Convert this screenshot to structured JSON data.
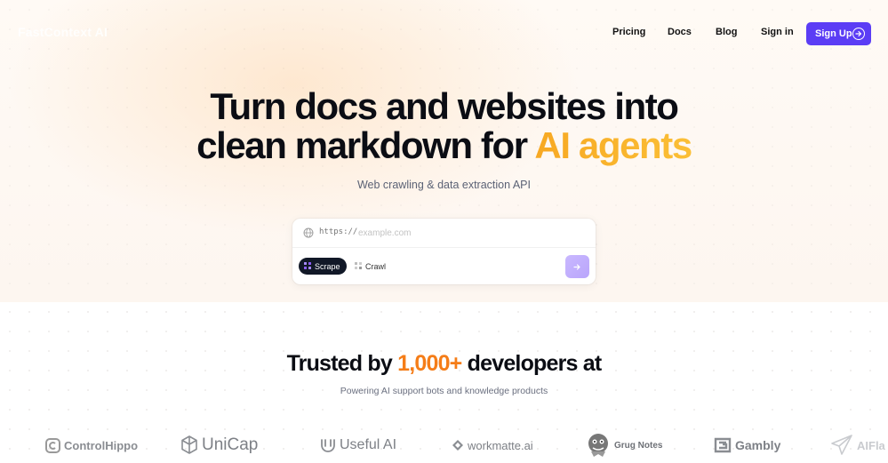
{
  "nav": {
    "logo": "FastContext AI",
    "links": [
      "Pricing",
      "Docs",
      "Blog",
      "Sign in"
    ],
    "signup_label": "Sign Up"
  },
  "hero": {
    "title_line1": "Turn docs and websites into",
    "title_line2_prefix": "clean markdown for ",
    "title_line2_accent": "AI agents",
    "subtitle": "Web crawling & data extraction API"
  },
  "search": {
    "prefix": "https://",
    "placeholder": "example.com",
    "value": "",
    "modes": [
      "Scrape",
      "Crawl"
    ],
    "active_mode": "Scrape"
  },
  "trusted": {
    "prefix": "Trusted by ",
    "count": "1,000+",
    "suffix": " developers at",
    "subtitle": "Powering AI support bots and knowledge products"
  },
  "logos": [
    "ControlHippo",
    "UniCap",
    "Useful AI",
    "workmatte.ai",
    "Grug Notes",
    "Gambly",
    "AIFla"
  ],
  "colors": {
    "accent": "#5b3df5",
    "highlight_yellow": "#f7a823",
    "highlight_orange": "#f57d18",
    "dark": "#111827"
  }
}
